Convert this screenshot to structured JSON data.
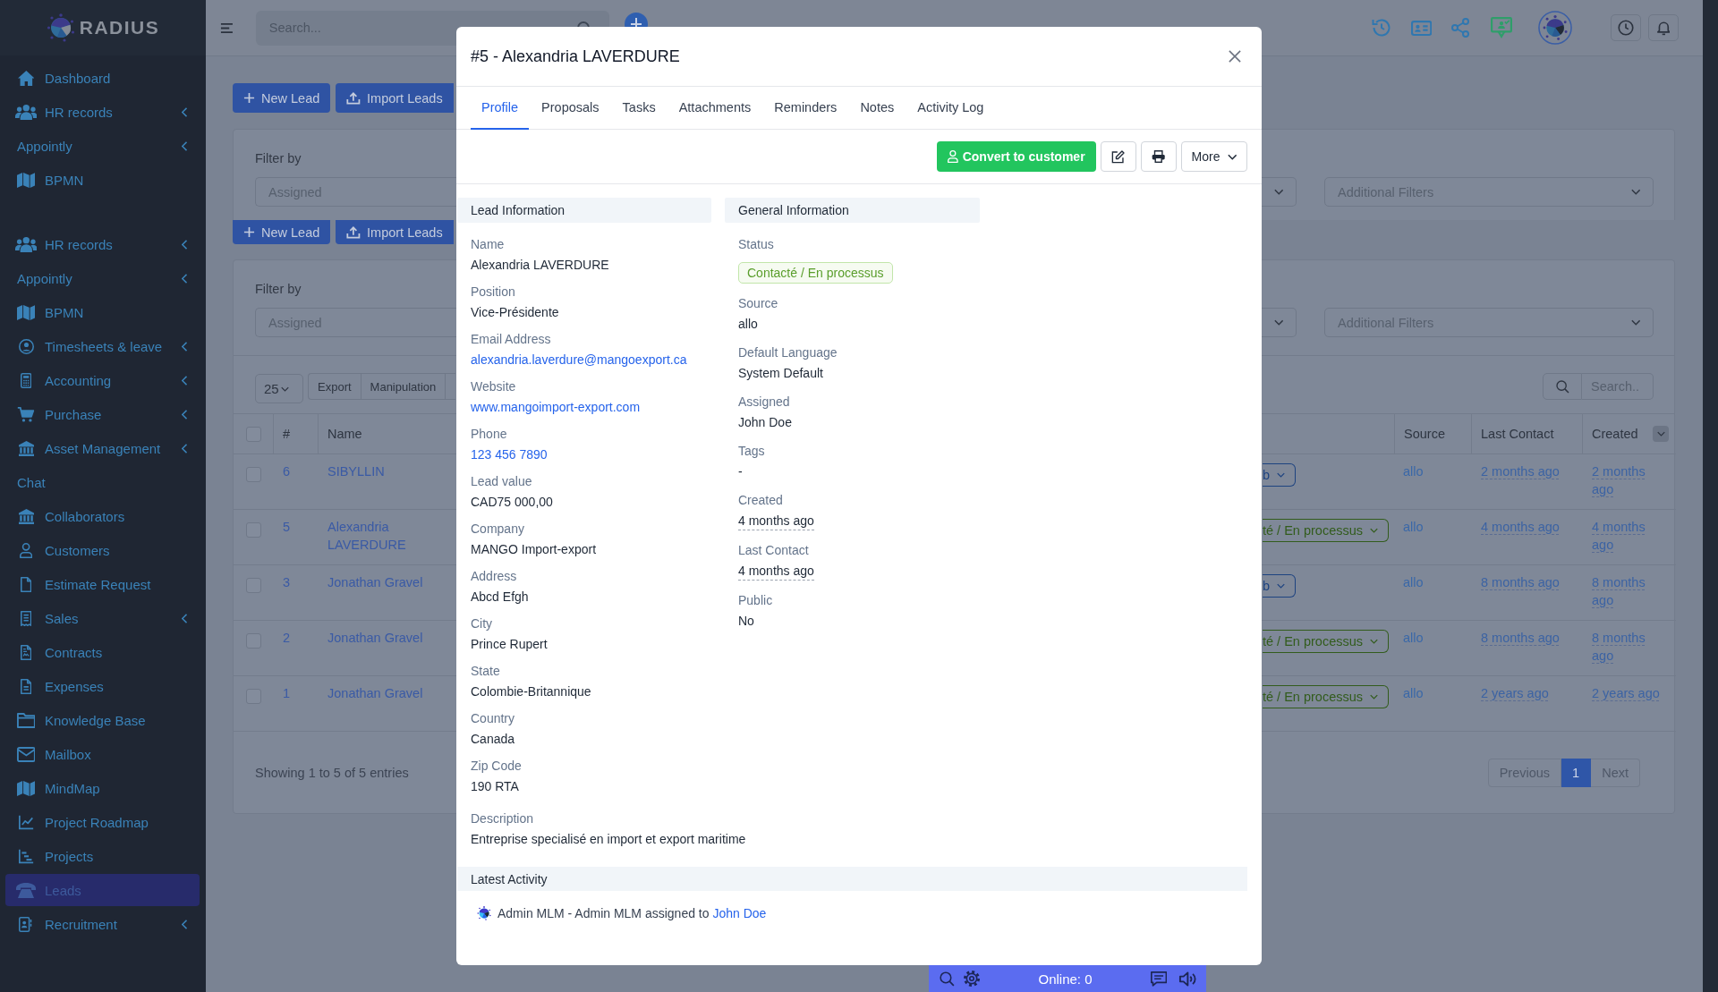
{
  "sidebar": {
    "logo": "RADIUS",
    "items_upper": [
      {
        "label": "Dashboard",
        "kind": "link",
        "expandable": false,
        "selected": false
      },
      {
        "label": "HR records",
        "kind": "link",
        "expandable": true,
        "selected": false
      },
      {
        "label": "Appointly",
        "kind": "heading",
        "expandable": true,
        "selected": false
      },
      {
        "label": "BPMN",
        "kind": "link",
        "expandable": false,
        "selected": false
      }
    ],
    "items": [
      {
        "label": "HR records",
        "kind": "link",
        "expandable": true,
        "selected": false
      },
      {
        "label": "Appointly",
        "kind": "heading",
        "expandable": true,
        "selected": false
      },
      {
        "label": "BPMN",
        "kind": "link",
        "expandable": false,
        "selected": false
      },
      {
        "label": "Timesheets & leave",
        "kind": "link",
        "expandable": true,
        "selected": false
      },
      {
        "label": "Accounting",
        "kind": "link",
        "expandable": true,
        "selected": false
      },
      {
        "label": "Purchase",
        "kind": "link",
        "expandable": true,
        "selected": false
      },
      {
        "label": "Asset Management",
        "kind": "link",
        "expandable": true,
        "selected": false
      },
      {
        "label": "Chat",
        "kind": "heading",
        "expandable": false,
        "selected": false
      },
      {
        "label": "Collaborators",
        "kind": "link",
        "expandable": false,
        "selected": false
      },
      {
        "label": "Customers",
        "kind": "link",
        "expandable": false,
        "selected": false
      },
      {
        "label": "Estimate Request",
        "kind": "link",
        "expandable": false,
        "selected": false
      },
      {
        "label": "Sales",
        "kind": "link",
        "expandable": true,
        "selected": false
      },
      {
        "label": "Contracts",
        "kind": "link",
        "expandable": false,
        "selected": false
      },
      {
        "label": "Expenses",
        "kind": "link",
        "expandable": false,
        "selected": false
      },
      {
        "label": "Knowledge Base",
        "kind": "link",
        "expandable": false,
        "selected": false
      },
      {
        "label": "Mailbox",
        "kind": "link",
        "expandable": false,
        "selected": false
      },
      {
        "label": "MindMap",
        "kind": "link",
        "expandable": false,
        "selected": false
      },
      {
        "label": "Project Roadmap",
        "kind": "link",
        "expandable": false,
        "selected": false
      },
      {
        "label": "Projects",
        "kind": "link",
        "expandable": false,
        "selected": false
      },
      {
        "label": "Leads",
        "kind": "link",
        "expandable": false,
        "selected": true
      },
      {
        "label": "Recruitment",
        "kind": "link",
        "expandable": true,
        "selected": false
      }
    ]
  },
  "topbar": {
    "search": {
      "placeholder": "Search..."
    }
  },
  "content_upper": {
    "buttons": [
      "New Lead",
      "Import Leads"
    ],
    "filter": {
      "label": "Filter by",
      "fields": [
        {
          "placeholder": "Assigned"
        },
        {
          "placeholder": "Additional Filters"
        }
      ]
    }
  },
  "content": {
    "buttons": [
      "New Lead",
      "Import Leads"
    ],
    "filter": {
      "label": "Filter by",
      "fields": [
        {
          "placeholder": "Assigned"
        },
        {
          "placeholder": "Additional Filters"
        }
      ]
    },
    "page_size": "25",
    "table_buttons": [
      "Export",
      "Manipulation"
    ],
    "search": {
      "placeholder": "Search.."
    },
    "table": {
      "select_all": {
        "checked": false
      },
      "columns": [
        "#",
        "Name",
        "Source",
        "Last Contact",
        "Created"
      ],
      "rows": [
        {
          "checked": false,
          "number": "6",
          "name": "SIBYLLIN",
          "status": {
            "text": "b",
            "color": "#1d4380"
          },
          "source": "allo",
          "last_contact": "2 months ago",
          "created": "2 months ago"
        },
        {
          "checked": false,
          "number": "5",
          "name": "Alexandria LAVERDURE",
          "status": {
            "text": "té / En processus",
            "color": "#325c1c"
          },
          "source": "allo",
          "last_contact": "4 months ago",
          "created": "4 months ago"
        },
        {
          "checked": false,
          "number": "3",
          "name": "Jonathan Gravel",
          "status": {
            "text": "b",
            "color": "#1d4380"
          },
          "source": "allo",
          "last_contact": "8 months ago",
          "created": "8 months ago"
        },
        {
          "checked": false,
          "number": "2",
          "name": "Jonathan Gravel",
          "status": {
            "text": "té / En processus",
            "color": "#325c1c"
          },
          "source": "allo",
          "last_contact": "8 months ago",
          "created": "8 months ago"
        },
        {
          "checked": false,
          "number": "1",
          "name": "Jonathan Gravel",
          "status": {
            "text": "té / En processus",
            "color": "#325c1c"
          },
          "source": "allo",
          "last_contact": "2 years ago",
          "created": "2 years ago"
        }
      ]
    },
    "footer": "Showing 1 to 5 of 5 entries",
    "pagination": [
      {
        "label": "Previous",
        "selected": false,
        "disabled": true
      },
      {
        "label": "1",
        "selected": true,
        "disabled": false
      },
      {
        "label": "Next",
        "selected": false,
        "disabled": true
      }
    ]
  },
  "modal": {
    "title": "#5 - Alexandria LAVERDURE",
    "tabs": [
      {
        "label": "Profile",
        "selected": true
      },
      {
        "label": "Proposals",
        "selected": false
      },
      {
        "label": "Tasks",
        "selected": false
      },
      {
        "label": "Attachments",
        "selected": false
      },
      {
        "label": "Reminders",
        "selected": false
      },
      {
        "label": "Notes",
        "selected": false
      },
      {
        "label": "Activity Log",
        "selected": false
      }
    ],
    "actions": {
      "convert": "Convert to customer",
      "more": "More"
    },
    "lead_information": {
      "title": "Lead Information",
      "fields": [
        {
          "label": "Name",
          "value": "Alexandria LAVERDURE",
          "kind": "text"
        },
        {
          "label": "Position",
          "value": "Vice-Présidente",
          "kind": "text"
        },
        {
          "label": "Email Address",
          "value": "alexandria.laverdure@mangoexport.ca",
          "kind": "link"
        },
        {
          "label": "Website",
          "value": "www.mangoimport-export.com",
          "kind": "link"
        },
        {
          "label": "Phone",
          "value": "123 456 7890",
          "kind": "link"
        },
        {
          "label": "Lead value",
          "value": "CAD75 000,00",
          "kind": "text"
        },
        {
          "label": "Company",
          "value": "MANGO Import-export",
          "kind": "text"
        },
        {
          "label": "Address",
          "value": "Abcd Efgh",
          "kind": "text"
        },
        {
          "label": "City",
          "value": "Prince Rupert",
          "kind": "text"
        },
        {
          "label": "State",
          "value": "Colombie-Britannique",
          "kind": "text"
        },
        {
          "label": "Country",
          "value": "Canada",
          "kind": "text"
        },
        {
          "label": "Zip Code",
          "value": "190 RTA",
          "kind": "text"
        }
      ]
    },
    "general_information": {
      "title": "General Information",
      "fields": [
        {
          "label": "Status",
          "value": "Contacté / En processus",
          "kind": "badge"
        },
        {
          "label": "Source",
          "value": "allo",
          "kind": "text"
        },
        {
          "label": "Default Language",
          "value": "System Default",
          "kind": "text"
        },
        {
          "label": "Assigned",
          "value": "John Doe",
          "kind": "text"
        },
        {
          "label": "Tags",
          "value": "-",
          "kind": "text"
        },
        {
          "label": "Created",
          "value": "4 months ago",
          "kind": "time"
        },
        {
          "label": "Last Contact",
          "value": "4 months ago",
          "kind": "time"
        },
        {
          "label": "Public",
          "value": "No",
          "kind": "text"
        }
      ]
    },
    "description": {
      "label": "Description",
      "value": "Entreprise specialisé en import et export maritime"
    },
    "latest_activity": {
      "title": "Latest Activity",
      "entries": [
        {
          "text": "Admin MLM - Admin MLM assigned to",
          "link": "John Doe"
        }
      ]
    }
  },
  "chat_bar": {
    "status": "Online: 0"
  }
}
